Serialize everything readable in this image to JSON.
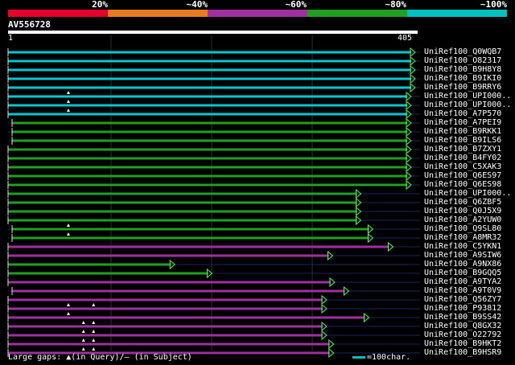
{
  "identity_legend": {
    "segments": [
      {
        "color": "#e8002c"
      },
      {
        "color": "#e87a1f"
      },
      {
        "color": "#a030a0"
      },
      {
        "color": "#20a020"
      },
      {
        "color": "#00c0c0"
      }
    ],
    "labels": [
      "20%",
      "~40%",
      "~60%",
      "~80%",
      "~100%"
    ]
  },
  "query": {
    "id": "AV556728",
    "start": "1",
    "end": "405"
  },
  "colors": {
    "cyan": "#00c8d0",
    "green": "#20a020",
    "magenta": "#a030a0",
    "subject_line": "#202060",
    "gap": "#ffffc0"
  },
  "hits": [
    {
      "label": "UniRef100_Q0WQB7",
      "color": "cyan",
      "segments": [
        [
          1,
          405
        ]
      ],
      "marks": []
    },
    {
      "label": "UniRef100_O82317",
      "color": "cyan",
      "segments": [
        [
          1,
          405
        ]
      ],
      "marks": []
    },
    {
      "label": "UniRef100_B9H8Y8",
      "color": "cyan",
      "segments": [
        [
          1,
          405
        ]
      ],
      "marks": []
    },
    {
      "label": "UniRef100_B9IKI0",
      "color": "cyan",
      "segments": [
        [
          1,
          405
        ]
      ],
      "marks": []
    },
    {
      "label": "UniRef100_B9RRY6",
      "color": "cyan",
      "segments": [
        [
          1,
          405
        ]
      ],
      "marks": []
    },
    {
      "label": "UniRef100_UPI000..",
      "color": "cyan",
      "segments": [
        [
          1,
          401
        ]
      ],
      "marks": [
        61
      ]
    },
    {
      "label": "UniRef100_UPI000..",
      "color": "cyan",
      "segments": [
        [
          1,
          401
        ]
      ],
      "marks": [
        61
      ]
    },
    {
      "label": "UniRef100_A7P570",
      "color": "cyan",
      "segments": [
        [
          1,
          401
        ]
      ],
      "marks": [
        61
      ]
    },
    {
      "label": "UniRef100_A7PEI9",
      "color": "green",
      "segments": [
        [
          5,
          401
        ]
      ],
      "marks": []
    },
    {
      "label": "UniRef100_B9RKK1",
      "color": "green",
      "segments": [
        [
          5,
          401
        ]
      ],
      "marks": []
    },
    {
      "label": "UniRef100_B9ILS6",
      "color": "green",
      "segments": [
        [
          5,
          401
        ]
      ],
      "marks": []
    },
    {
      "label": "UniRef100_B7ZXY1",
      "color": "green",
      "segments": [
        [
          1,
          401
        ]
      ],
      "marks": []
    },
    {
      "label": "UniRef100_B4FY02",
      "color": "green",
      "segments": [
        [
          1,
          401
        ]
      ],
      "marks": []
    },
    {
      "label": "UniRef100_C5XAK3",
      "color": "green",
      "segments": [
        [
          1,
          401
        ]
      ],
      "marks": []
    },
    {
      "label": "UniRef100_Q6ES97",
      "color": "green",
      "segments": [
        [
          1,
          401
        ]
      ],
      "marks": []
    },
    {
      "label": "UniRef100_Q6ES98",
      "color": "green",
      "segments": [
        [
          1,
          401
        ]
      ],
      "marks": []
    },
    {
      "label": "UniRef100_UPI000..",
      "color": "green",
      "segments": [
        [
          1,
          351
        ]
      ],
      "marks": []
    },
    {
      "label": "UniRef100_Q6ZBF5",
      "color": "green",
      "segments": [
        [
          1,
          351
        ]
      ],
      "marks": []
    },
    {
      "label": "UniRef100_Q0J5X9",
      "color": "green",
      "segments": [
        [
          1,
          351
        ]
      ],
      "marks": []
    },
    {
      "label": "UniRef100_A2YUW0",
      "color": "green",
      "segments": [
        [
          1,
          351
        ]
      ],
      "marks": []
    },
    {
      "label": "UniRef100_Q9SL80",
      "color": "green",
      "segments": [
        [
          5,
          363
        ]
      ],
      "marks": [
        61
      ]
    },
    {
      "label": "UniRef100_A8MR32",
      "color": "green",
      "segments": [
        [
          5,
          363
        ]
      ],
      "marks": [
        61
      ]
    },
    {
      "label": "UniRef100_C5YKN1",
      "color": "magenta",
      "segments": [
        [
          1,
          383
        ]
      ],
      "marks": []
    },
    {
      "label": "UniRef100_A9SIW6",
      "color": "magenta",
      "segments": [
        [
          1,
          323
        ]
      ],
      "marks": []
    },
    {
      "label": "UniRef100_A9NX86",
      "color": "green",
      "segments": [
        [
          1,
          166
        ]
      ],
      "marks": []
    },
    {
      "label": "UniRef100_B9GQQ5",
      "color": "green",
      "segments": [
        [
          1,
          203
        ]
      ],
      "marks": []
    },
    {
      "label": "UniRef100_A9TYA2",
      "color": "magenta",
      "segments": [
        [
          1,
          325
        ]
      ],
      "marks": []
    },
    {
      "label": "UniRef100_A9T0V9",
      "color": "magenta",
      "segments": [
        [
          5,
          339
        ]
      ],
      "marks": []
    },
    {
      "label": "UniRef100_Q56ZY7",
      "color": "magenta",
      "segments": [
        [
          1,
          317
        ]
      ],
      "marks": []
    },
    {
      "label": "UniRef100_P93812",
      "color": "magenta",
      "segments": [
        [
          1,
          317
        ]
      ],
      "marks": [
        61,
        86
      ]
    },
    {
      "label": "UniRef100_B9SS42",
      "color": "magenta",
      "segments": [
        [
          1,
          359
        ]
      ],
      "marks": [
        61
      ]
    },
    {
      "label": "UniRef100_Q8GX32",
      "color": "magenta",
      "segments": [
        [
          1,
          317
        ]
      ],
      "marks": [
        76,
        86
      ]
    },
    {
      "label": "UniRef100_O22792",
      "color": "magenta",
      "segments": [
        [
          1,
          317
        ]
      ],
      "marks": [
        76,
        86
      ]
    },
    {
      "label": "UniRef100_B9HKT2",
      "color": "magenta",
      "segments": [
        [
          1,
          324
        ]
      ],
      "marks": [
        76,
        86
      ]
    },
    {
      "label": "UniRef100_B9HSR9",
      "color": "magenta",
      "segments": [
        [
          1,
          324
        ]
      ],
      "marks": [
        76,
        86
      ]
    }
  ],
  "footer": {
    "gaps_text": "Large gaps: ",
    "query_symbol": "▲",
    "query_text": "(in Query)/",
    "subject_symbol": "–",
    "subject_text": " (in Subject)",
    "scale_text": "=100char."
  }
}
